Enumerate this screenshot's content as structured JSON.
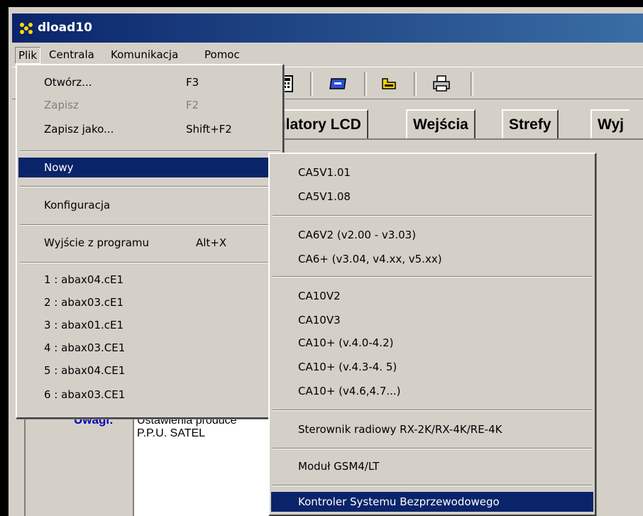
{
  "window": {
    "title": "dload10"
  },
  "menubar": [
    "Plik",
    "Centrala",
    "Komunikacja",
    "Pomoc"
  ],
  "toolbar": {
    "icons": [
      "calculator-icon",
      "modem-icon",
      "device-icon",
      "printer-icon"
    ]
  },
  "tabs": [
    "pulatory LCD",
    "Wejścia",
    "Strefy",
    "Wyj"
  ],
  "uwagi": {
    "label": "Uwagi:",
    "lines": [
      "Ustawienia produce",
      "P.P.U. SATEL"
    ]
  },
  "plik_menu": {
    "items": [
      {
        "label": "Otwórz...",
        "shortcut": "F3"
      },
      {
        "label": "Zapisz",
        "shortcut": "F2"
      },
      {
        "label": "Zapisz jako...",
        "shortcut": "Shift+F2"
      },
      {
        "label": "Nowy"
      },
      {
        "label": "Konfiguracja"
      },
      {
        "label": "Wyjście z programu",
        "shortcut": "Alt+X"
      },
      {
        "label": "1 : abax04.cE1"
      },
      {
        "label": "2 : abax03.cE1"
      },
      {
        "label": "3 : abax01.cE1"
      },
      {
        "label": "4 : abax03.CE1"
      },
      {
        "label": "5 : abax04.CE1"
      },
      {
        "label": "6 : abax03.CE1"
      }
    ]
  },
  "nowy_submenu": {
    "items": [
      "CA5V1.01",
      "CA5V1.08",
      "CA6V2 (v2.00 - v3.03)",
      "CA6+ (v3.04, v4.xx, v5.xx)",
      "CA10V2",
      "CA10V3",
      "CA10+ (v.4.0-4.2)",
      "CA10+ (v.4.3-4. 5)",
      "CA10+ (v4.6,4.7...)",
      "Sterownik radiowy RX-2K/RX-4K/RE-4K",
      "Moduł GSM4/LT",
      "Kontroler Systemu Bezprzewodowego"
    ]
  },
  "colors": {
    "highlight": "#0a246a",
    "face": "#d4d0c8",
    "title_gradient_end": "#3a6ea5",
    "uwagi_label": "#0000c0"
  }
}
